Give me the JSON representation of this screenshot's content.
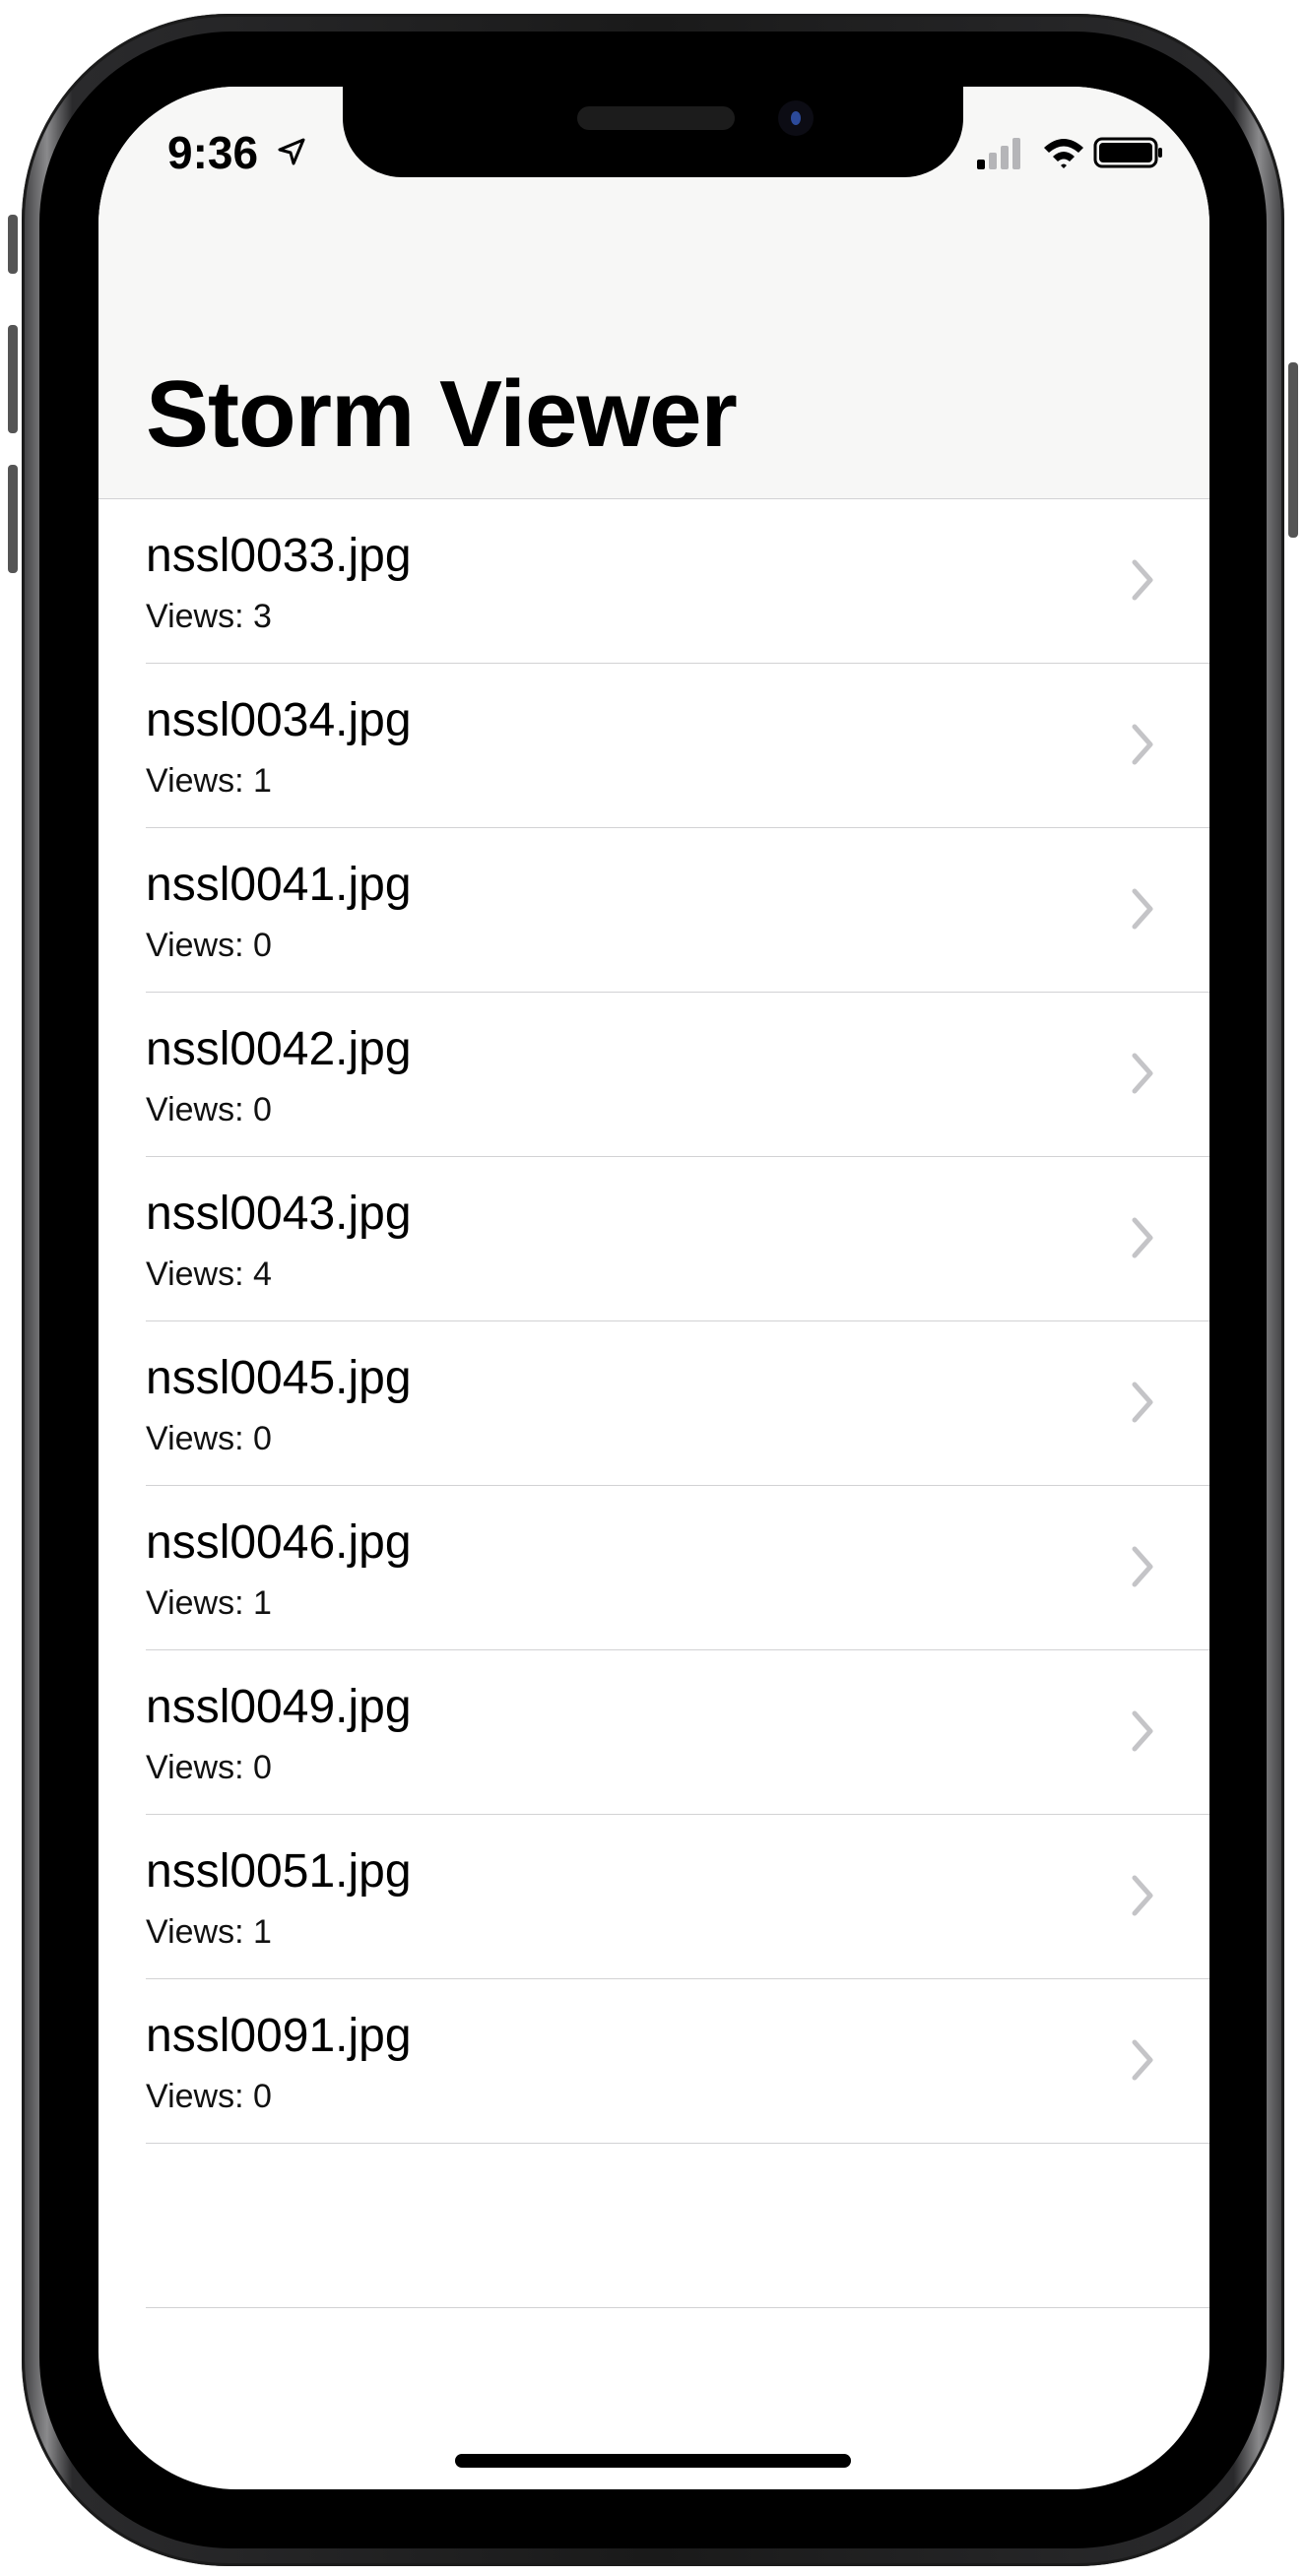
{
  "status_bar": {
    "time": "9:36"
  },
  "nav": {
    "title": "Storm Viewer"
  },
  "pictures": [
    {
      "name": "nssl0033.jpg",
      "views": "Views: 3"
    },
    {
      "name": "nssl0034.jpg",
      "views": "Views: 1"
    },
    {
      "name": "nssl0041.jpg",
      "views": "Views: 0"
    },
    {
      "name": "nssl0042.jpg",
      "views": "Views: 0"
    },
    {
      "name": "nssl0043.jpg",
      "views": "Views: 4"
    },
    {
      "name": "nssl0045.jpg",
      "views": "Views: 0"
    },
    {
      "name": "nssl0046.jpg",
      "views": "Views: 1"
    },
    {
      "name": "nssl0049.jpg",
      "views": "Views: 0"
    },
    {
      "name": "nssl0051.jpg",
      "views": "Views: 1"
    },
    {
      "name": "nssl0091.jpg",
      "views": "Views: 0"
    }
  ],
  "icons": {
    "location": "location-arrow-icon",
    "signal": "cellular-signal-icon",
    "wifi": "wifi-icon",
    "battery": "battery-icon",
    "chevron": "chevron-right-icon"
  },
  "colors": {
    "nav_background": "#f7f7f6",
    "separator": "#d2d2d4",
    "chevron": "#c4c4c7",
    "text": "#000000"
  }
}
